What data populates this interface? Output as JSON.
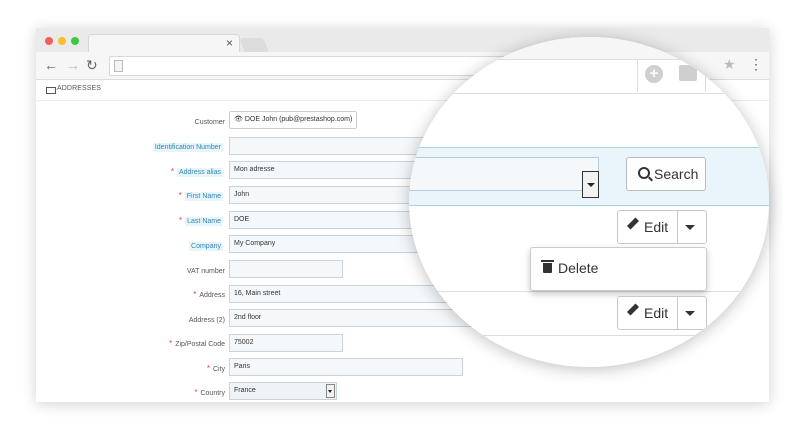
{
  "browser": {
    "tab_close": "×"
  },
  "breadcrumb": {
    "label": "ADDRESSES"
  },
  "form": {
    "customer": {
      "label": "Customer",
      "value": "👁 DOE John (pub@prestashop.com)"
    },
    "identification_number": {
      "label": "Identification Number",
      "value": ""
    },
    "address_alias": {
      "label": "Address alias",
      "value": "Mon adresse",
      "required": true
    },
    "first_name": {
      "label": "First Name",
      "value": "John",
      "required": true
    },
    "last_name": {
      "label": "Last Name",
      "value": "DOE",
      "required": true
    },
    "company": {
      "label": "Company",
      "value": "My Company"
    },
    "vat_number": {
      "label": "VAT number",
      "value": ""
    },
    "address": {
      "label": "Address",
      "value": "16, Main street",
      "required": true
    },
    "address2": {
      "label": "Address (2)",
      "value": "2nd floor"
    },
    "zip": {
      "label": "Zip/Postal Code",
      "value": "75002",
      "required": true
    },
    "city": {
      "label": "City",
      "value": "Paris",
      "required": true
    },
    "country": {
      "label": "Country",
      "value": "France",
      "required": true
    },
    "required_mark": "*"
  },
  "zoom": {
    "search_label": "Search",
    "edit_label": "Edit",
    "delete_label": "Delete"
  },
  "colors": {
    "label_highlight_bg": "#e6f4fb",
    "label_highlight_text": "#3586ae",
    "required": "#e5472b",
    "input_bg": "#f4f8fb"
  },
  "icons": [
    "back-arrow-icon",
    "forward-arrow-icon",
    "reload-icon",
    "page-icon",
    "star-icon",
    "menu-dots-icon",
    "envelope-icon",
    "eye-icon",
    "search-icon",
    "pencil-icon",
    "caret-down-icon",
    "trash-icon",
    "plus-circle-icon",
    "image-icon"
  ]
}
